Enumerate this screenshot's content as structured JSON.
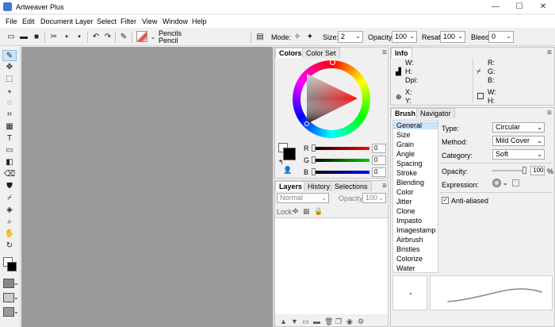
{
  "window": {
    "title": "Artweaver Plus",
    "minimize": "—",
    "maximize": "☐",
    "close": "✕"
  },
  "menu": [
    "File",
    "Edit",
    "Document",
    "Layer",
    "Select",
    "Filter",
    "View",
    "Window",
    "Help"
  ],
  "toolbar": {
    "preset_category": "Pencils",
    "preset_name": "Pencil",
    "mode_label": "Mode:",
    "size_label": "Size:",
    "size_value": "2",
    "opacity_label": "Opacity:",
    "opacity_value": "100",
    "resat_label": "Resat:",
    "resat_value": "100",
    "bleed_label": "Bleed:",
    "bleed_value": "0"
  },
  "colors_panel": {
    "tabs": [
      "Colors",
      "Color Set"
    ],
    "r_label": "R",
    "r_value": "0",
    "g_label": "G",
    "g_value": "0",
    "b_label": "B",
    "b_value": "0"
  },
  "layers_panel": {
    "tabs": [
      "Layers",
      "History",
      "Selections"
    ],
    "blend_mode": "Normal",
    "opacity_label": "Opacity:",
    "opacity_value": "100",
    "lock_label": "Lock:"
  },
  "info_panel": {
    "tab": "Info",
    "w_label": "W:",
    "h_label": "H:",
    "dpi_label": "Dpi:",
    "r_label": "R:",
    "g_label": "G:",
    "b_label": "B:",
    "x_label": "X:",
    "y_label": "Y:",
    "w2_label": "W:",
    "h2_label": "H:"
  },
  "brush_panel": {
    "tabs": [
      "Brush",
      "Navigator"
    ],
    "categories": [
      "General",
      "Size",
      "Grain",
      "Angle",
      "Spacing",
      "Stroke",
      "Blending",
      "Color",
      "Jitter",
      "Clone",
      "Impasto",
      "Imagestamp",
      "Airbrush",
      "Bristles",
      "Colorize",
      "Water"
    ],
    "type_label": "Type:",
    "type_value": "Circular",
    "method_label": "Method:",
    "method_value": "Mild Cover",
    "category_label": "Category:",
    "category_value": "Soft",
    "opacity_label": "Opacity:",
    "opacity_value": "100",
    "opacity_unit": "%",
    "expression_label": "Expression:",
    "antialiased_label": "Anti-aliased"
  }
}
